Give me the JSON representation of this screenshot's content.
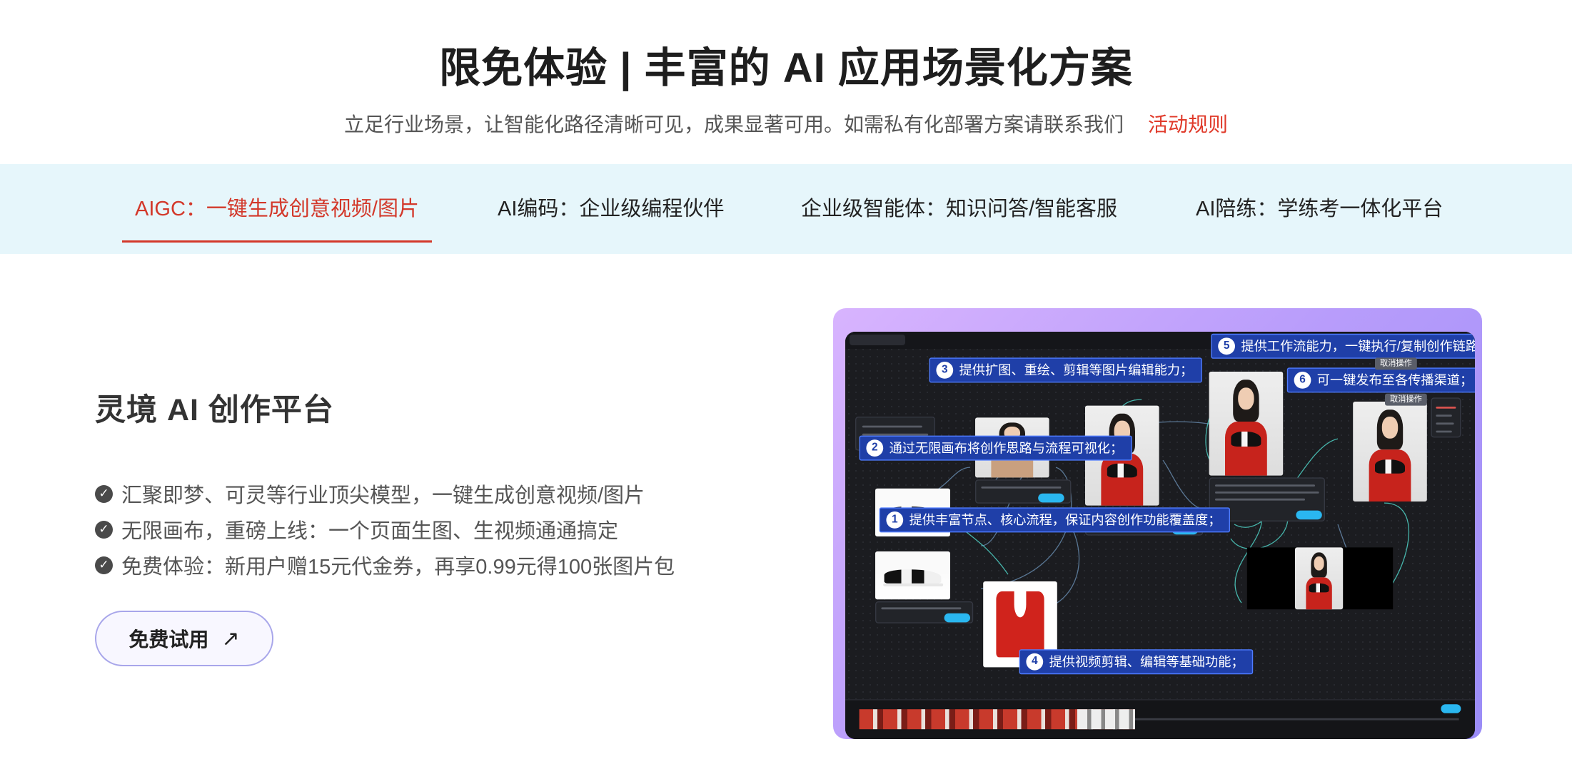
{
  "hero": {
    "title": "限免体验 | 丰富的 AI 应用场景化方案",
    "subtitle": "立足行业场景，让智能化路径清晰可见，成果显著可用。如需私有化部署方案请联系我们",
    "rules_link": "活动规则"
  },
  "tabs": [
    {
      "label": "AIGC：一键生成创意视频/图片",
      "active": true
    },
    {
      "label": "AI编码：企业级编程伙伴",
      "active": false
    },
    {
      "label": "企业级智能体：知识问答/智能客服",
      "active": false
    },
    {
      "label": "AI陪练：学练考一体化平台",
      "active": false
    }
  ],
  "product": {
    "title": "灵境 AI 创作平台",
    "features": [
      "汇聚即梦、可灵等行业顶尖模型，一键生成创意视频/图片",
      "无限画布，重磅上线：一个页面生图、生视频通通搞定",
      "免费体验：新用户赠15元代金券，再享0.99元得100张图片包"
    ],
    "cta_label": "免费试用",
    "cta_icon": "arrow-up-right-icon"
  },
  "showcase": {
    "callouts": [
      {
        "num": "1",
        "text": "提供丰富节点、核心流程，保证内容创作功能覆盖度；"
      },
      {
        "num": "2",
        "text": "通过无限画布将创作思路与流程可视化；"
      },
      {
        "num": "3",
        "text": "提供扩图、重绘、剪辑等图片编辑能力；"
      },
      {
        "num": "4",
        "text": "提供视频剪辑、编辑等基础功能；"
      },
      {
        "num": "5",
        "text": "提供工作流能力，一键执行/复制创作链路；"
      },
      {
        "num": "6",
        "text": "可一键发布至各传播渠道；"
      }
    ],
    "tags": [
      "取消操作",
      "取消操作"
    ],
    "accent": "#1f3fa8"
  },
  "colors": {
    "brand_red": "#d3382a",
    "tab_bg": "#e6f6fb",
    "cta_border": "#a8a6ea"
  }
}
